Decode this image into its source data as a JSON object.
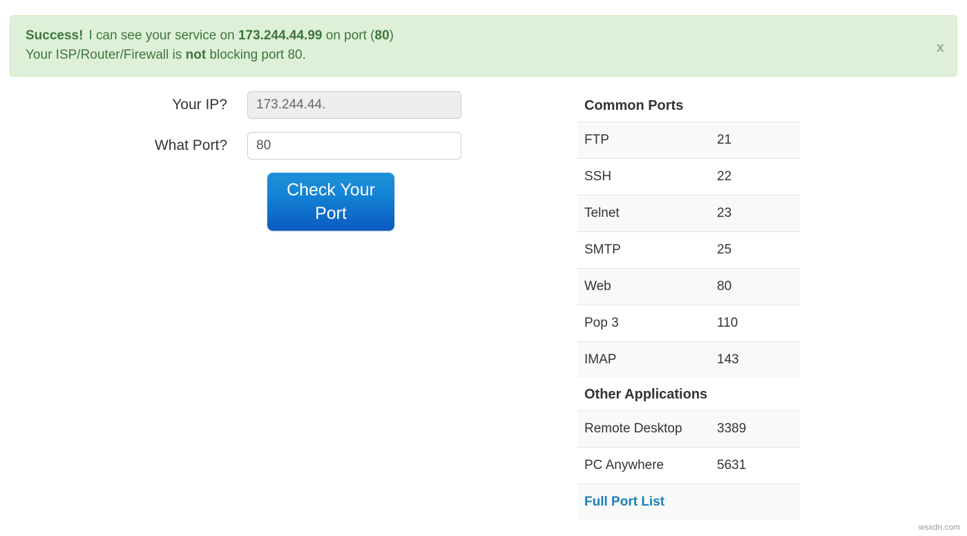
{
  "alert": {
    "status_label": "Success!",
    "line1_pre": "I can see your service on ",
    "line1_ip": "173.244.44.99",
    "line1_mid": " on port (",
    "line1_port": "80",
    "line1_post": ")",
    "line2_pre": "Your ISP/Router/Firewall is ",
    "line2_emph": "not",
    "line2_post": " blocking port 80.",
    "close_label": "x",
    "bg_color": "#dff0d8",
    "text_color": "#3c763d"
  },
  "form": {
    "ip_label": "Your IP?",
    "ip_value": "173.244.44.",
    "port_label": "What Port?",
    "port_value": "80",
    "submit_label": "Check Your Port",
    "button_color": "#1383d4"
  },
  "ports_panel": {
    "common_heading": "Common Ports",
    "common_ports": [
      {
        "name": "FTP",
        "port": "21"
      },
      {
        "name": "SSH",
        "port": "22"
      },
      {
        "name": "Telnet",
        "port": "23"
      },
      {
        "name": "SMTP",
        "port": "25"
      },
      {
        "name": "Web",
        "port": "80"
      },
      {
        "name": "Pop 3",
        "port": "110"
      },
      {
        "name": "IMAP",
        "port": "143"
      }
    ],
    "other_heading": "Other Applications",
    "other_apps": [
      {
        "name": "Remote Desktop",
        "port": "3389"
      },
      {
        "name": "PC Anywhere",
        "port": "5631"
      }
    ],
    "full_list_label": "Full Port List",
    "link_color": "#1a7fb5"
  },
  "watermark": "wsxdn.com"
}
